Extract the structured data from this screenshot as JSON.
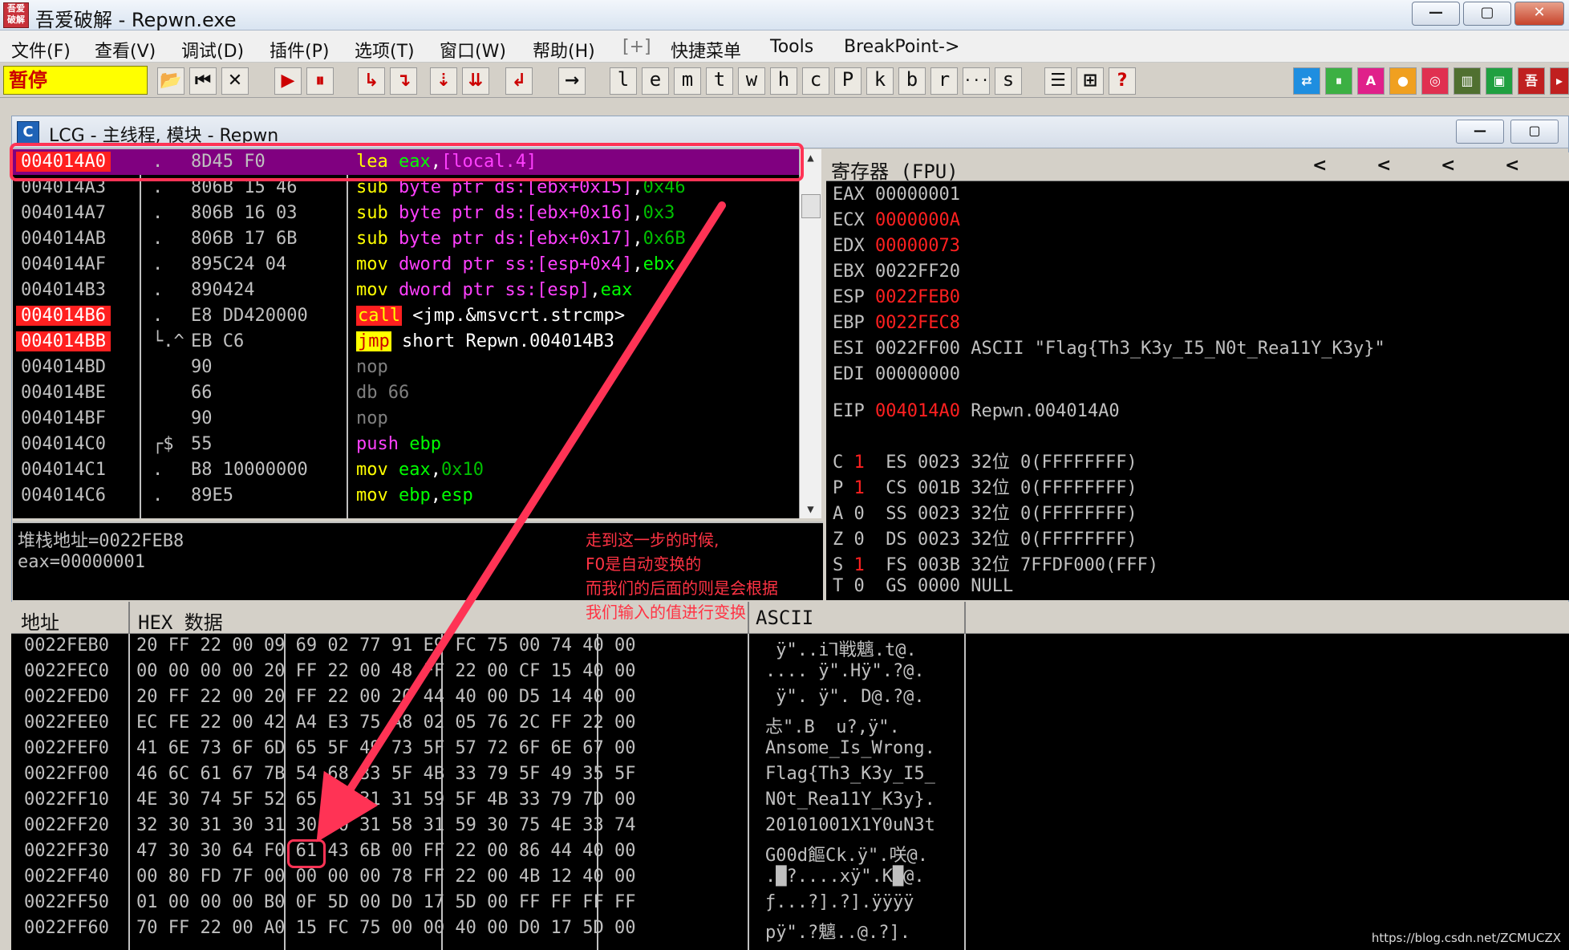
{
  "window": {
    "title": "吾爱破解 - Repwn.exe",
    "logo_text": "吾爱破解",
    "min": "—",
    "max": "▢",
    "close": "✕"
  },
  "menu": [
    "文件(F)",
    "查看(V)",
    "调试(D)",
    "插件(P)",
    "选项(T)",
    "窗口(W)",
    "帮助(H)",
    "[+]",
    "快捷菜单",
    "Tools",
    "BreakPoint->"
  ],
  "toolbar": {
    "status": "暂停",
    "debug_buttons": [
      "open",
      "rewind",
      "close",
      "run",
      "pause",
      "step-into",
      "step-over",
      "trace-into",
      "trace-over",
      "execute-till-return",
      "goto"
    ],
    "letters": [
      "l",
      "e",
      "m",
      "t",
      "w",
      "h",
      "c",
      "P",
      "k",
      "b",
      "r",
      "...",
      "s"
    ],
    "right_buttons": [
      "A",
      "?"
    ]
  },
  "cpu_window": {
    "icon_letter": "C",
    "title": "LCG - 主线程, 模块 - Repwn"
  },
  "disassembly": [
    {
      "addr": "004014A0",
      "bp": false,
      "mark": ".",
      "hex": "8D45 F0",
      "mn": "lea",
      "ops": [
        [
          "c-reg",
          "eax"
        ],
        [
          "c-white",
          ","
        ],
        [
          "c-ptr",
          "[local.4]"
        ]
      ],
      "selected": true
    },
    {
      "addr": "004014A3",
      "bp": false,
      "mark": ".",
      "hex": "806B 15 46",
      "mn": "sub",
      "ops": [
        [
          "c-ptr",
          "byte ptr ds:[ebx+0x15]"
        ],
        [
          "c-white",
          ","
        ],
        [
          "c-num",
          "0x46"
        ]
      ]
    },
    {
      "addr": "004014A7",
      "bp": false,
      "mark": ".",
      "hex": "806B 16 03",
      "mn": "sub",
      "ops": [
        [
          "c-ptr",
          "byte ptr ds:[ebx+0x16]"
        ],
        [
          "c-white",
          ","
        ],
        [
          "c-num",
          "0x3"
        ]
      ]
    },
    {
      "addr": "004014AB",
      "bp": false,
      "mark": ".",
      "hex": "806B 17 6B",
      "mn": "sub",
      "ops": [
        [
          "c-ptr",
          "byte ptr ds:[ebx+0x17]"
        ],
        [
          "c-white",
          ","
        ],
        [
          "c-num",
          "0x6B"
        ]
      ]
    },
    {
      "addr": "004014AF",
      "bp": false,
      "mark": ".",
      "hex": "895C24 04",
      "mn": "mov",
      "ops": [
        [
          "c-ptr",
          "dword ptr ss:[esp+0x4]"
        ],
        [
          "c-white",
          ","
        ],
        [
          "c-reg",
          "ebx"
        ]
      ]
    },
    {
      "addr": "004014B3",
      "bp": false,
      "mark": ".",
      "hex": "890424",
      "mn": "mov",
      "ops": [
        [
          "c-ptr",
          "dword ptr ss:[esp]"
        ],
        [
          "c-white",
          ","
        ],
        [
          "c-reg",
          "eax"
        ]
      ]
    },
    {
      "addr": "004014B6",
      "bp": true,
      "mark": ".",
      "hex": "E8 DD420000",
      "mn": "call",
      "mn_style": "c-call",
      "ops": [
        [
          "c-white",
          "<jmp.&msvcrt.strcmp>"
        ]
      ]
    },
    {
      "addr": "004014BB",
      "bp": true,
      "mark": "└.^",
      "hex": "EB C6",
      "mn": "jmp",
      "mn_style": "c-jmp",
      "ops": [
        [
          "c-white",
          "short Repwn.004014B3"
        ]
      ]
    },
    {
      "addr": "004014BD",
      "bp": false,
      "mark": "",
      "hex": "90",
      "mn": "nop",
      "mn_style": "c-gray",
      "ops": []
    },
    {
      "addr": "004014BE",
      "bp": false,
      "mark": "",
      "hex": "66",
      "mn": "db 66",
      "mn_style": "c-gray",
      "ops": []
    },
    {
      "addr": "004014BF",
      "bp": false,
      "mark": "",
      "hex": "90",
      "mn": "nop",
      "mn_style": "c-gray",
      "ops": []
    },
    {
      "addr": "004014C0",
      "bp": false,
      "mark": "┌$",
      "hex": "55",
      "mn": "push",
      "mn_style": "c-ptr",
      "ops": [
        [
          "c-reg",
          "ebp"
        ]
      ]
    },
    {
      "addr": "004014C1",
      "bp": false,
      "mark": ".",
      "hex": "B8 10000000",
      "mn": "mov",
      "ops": [
        [
          "c-reg",
          "eax"
        ],
        [
          "c-white",
          ","
        ],
        [
          "c-num",
          "0x10"
        ]
      ]
    },
    {
      "addr": "004014C6",
      "bp": false,
      "mark": ".",
      "hex": "89E5",
      "mn": "mov",
      "ops": [
        [
          "c-reg",
          "ebp"
        ],
        [
          "c-white",
          ","
        ],
        [
          "c-reg",
          "esp"
        ]
      ]
    }
  ],
  "info": {
    "line1": "堆栈地址=0022FEB8",
    "line2": "eax=00000001"
  },
  "registers": {
    "header": "寄存器 (FPU)",
    "arrows": [
      "<",
      "<",
      "<",
      "<"
    ],
    "gp": [
      {
        "name": "EAX",
        "value": "00000001",
        "changed": false,
        "extra": ""
      },
      {
        "name": "ECX",
        "value": "0000000A",
        "changed": true,
        "extra": ""
      },
      {
        "name": "EDX",
        "value": "00000073",
        "changed": true,
        "extra": ""
      },
      {
        "name": "EBX",
        "value": "0022FF20",
        "changed": false,
        "extra": ""
      },
      {
        "name": "ESP",
        "value": "0022FEB0",
        "changed": true,
        "extra": ""
      },
      {
        "name": "EBP",
        "value": "0022FEC8",
        "changed": true,
        "extra": ""
      },
      {
        "name": "ESI",
        "value": "0022FF00",
        "changed": false,
        "extra": "ASCII \"Flag{Th3_K3y_I5_N0t_Rea11Y_K3y}\""
      },
      {
        "name": "EDI",
        "value": "00000000",
        "changed": false,
        "extra": ""
      }
    ],
    "eip": {
      "name": "EIP",
      "value": "004014A0",
      "extra": "Repwn.004014A0"
    },
    "flags": [
      {
        "flag": "C",
        "bit": "1",
        "bit_changed": true,
        "seg": "ES",
        "sel": "0023",
        "bits": "32位",
        "base": "0(FFFFFFFF)"
      },
      {
        "flag": "P",
        "bit": "1",
        "bit_changed": true,
        "seg": "CS",
        "sel": "001B",
        "bits": "32位",
        "base": "0(FFFFFFFF)"
      },
      {
        "flag": "A",
        "bit": "0",
        "bit_changed": false,
        "seg": "SS",
        "sel": "0023",
        "bits": "32位",
        "base": "0(FFFFFFFF)"
      },
      {
        "flag": "Z",
        "bit": "0",
        "bit_changed": false,
        "seg": "DS",
        "sel": "0023",
        "bits": "32位",
        "base": "0(FFFFFFFF)"
      },
      {
        "flag": "S",
        "bit": "1",
        "bit_changed": true,
        "seg": "FS",
        "sel": "003B",
        "bits": "32位",
        "base": "7FFDF000(FFF)"
      },
      {
        "flag": "T",
        "bit": "0",
        "bit_changed": false,
        "seg": "GS",
        "sel": "0000",
        "bits": "NULL",
        "base": ""
      }
    ]
  },
  "dump": {
    "headers": {
      "addr": "地址",
      "hex": "HEX 数据",
      "ascii": "ASCII"
    },
    "rows": [
      {
        "addr": "0022FEB0",
        "hex": "20 FF 22 00 09 69 02 77 91 E9 FC 75 00 74 40 00",
        "ascii": " ÿ\"..i⅂戦魑.t@."
      },
      {
        "addr": "0022FEC0",
        "hex": "00 00 00 00 20 FF 22 00 48 FF 22 00 CF 15 40 00",
        "ascii": ".... ÿ\".Hÿ\".?@."
      },
      {
        "addr": "0022FED0",
        "hex": "20 FF 22 00 20 FF 22 00 20 44 40 00 D5 14 40 00",
        "ascii": " ÿ\". ÿ\". D@.?@."
      },
      {
        "addr": "0022FEE0",
        "hex": "EC FE 22 00 42 A4 E3 75 A8 02 05 76 2C FF 22 00",
        "ascii": "忐\".B  u?,ÿ\"."
      },
      {
        "addr": "0022FEF0",
        "hex": "41 6E 73 6F 6D 65 5F 49 73 5F 57 72 6F 6E 67 00",
        "ascii": "Ansome_Is_Wrong."
      },
      {
        "addr": "0022FF00",
        "hex": "46 6C 61 67 7B 54 68 33 5F 4B 33 79 5F 49 35 5F",
        "ascii": "Flag{Th3_K3y_I5_"
      },
      {
        "addr": "0022FF10",
        "hex": "4E 30 74 5F 52 65 61 31 31 59 5F 4B 33 79 7D 00",
        "ascii": "N0t_Rea11Y_K3y}."
      },
      {
        "addr": "0022FF20",
        "hex": "32 30 31 30 31 30 30 31 58 31 59 30 75 4E 33 74",
        "ascii": "20101001X1Y0uN3t"
      },
      {
        "addr": "0022FF30",
        "hex": "47 30 30 64 F0 61 43 6B 00 FF 22 00 86 44 40 00",
        "ascii": "G00d饇Ck.ÿ\".咲@."
      },
      {
        "addr": "0022FF40",
        "hex": "00 80 FD 7F 00 00 00 00 78 FF 22 00 4B 12 40 00",
        "ascii": ".█?....xÿ\".K█@."
      },
      {
        "addr": "0022FF50",
        "hex": "01 00 00 00 B0 0F 5D 00 D0 17 5D 00 FF FF FF FF",
        "ascii": "ƒ...?].?].ÿÿÿÿ"
      },
      {
        "addr": "0022FF60",
        "hex": "70 FF 22 00 A0 15 FC 75 00 00 40 00 D0 17 5D 00",
        "ascii": "pÿ\".?魑..@.?]."
      }
    ]
  },
  "annotation": {
    "text": "走到这一步的时候,\nF0是自动变换的\n而我们的后面的则是会根据\n我们输入的值进行变换"
  },
  "watermark": "https://blog.csdn.net/ZCMUCZX",
  "colors": {
    "highlight": "#ff3355",
    "selected_row": "#800080",
    "breakpoint": "#ff2020"
  }
}
